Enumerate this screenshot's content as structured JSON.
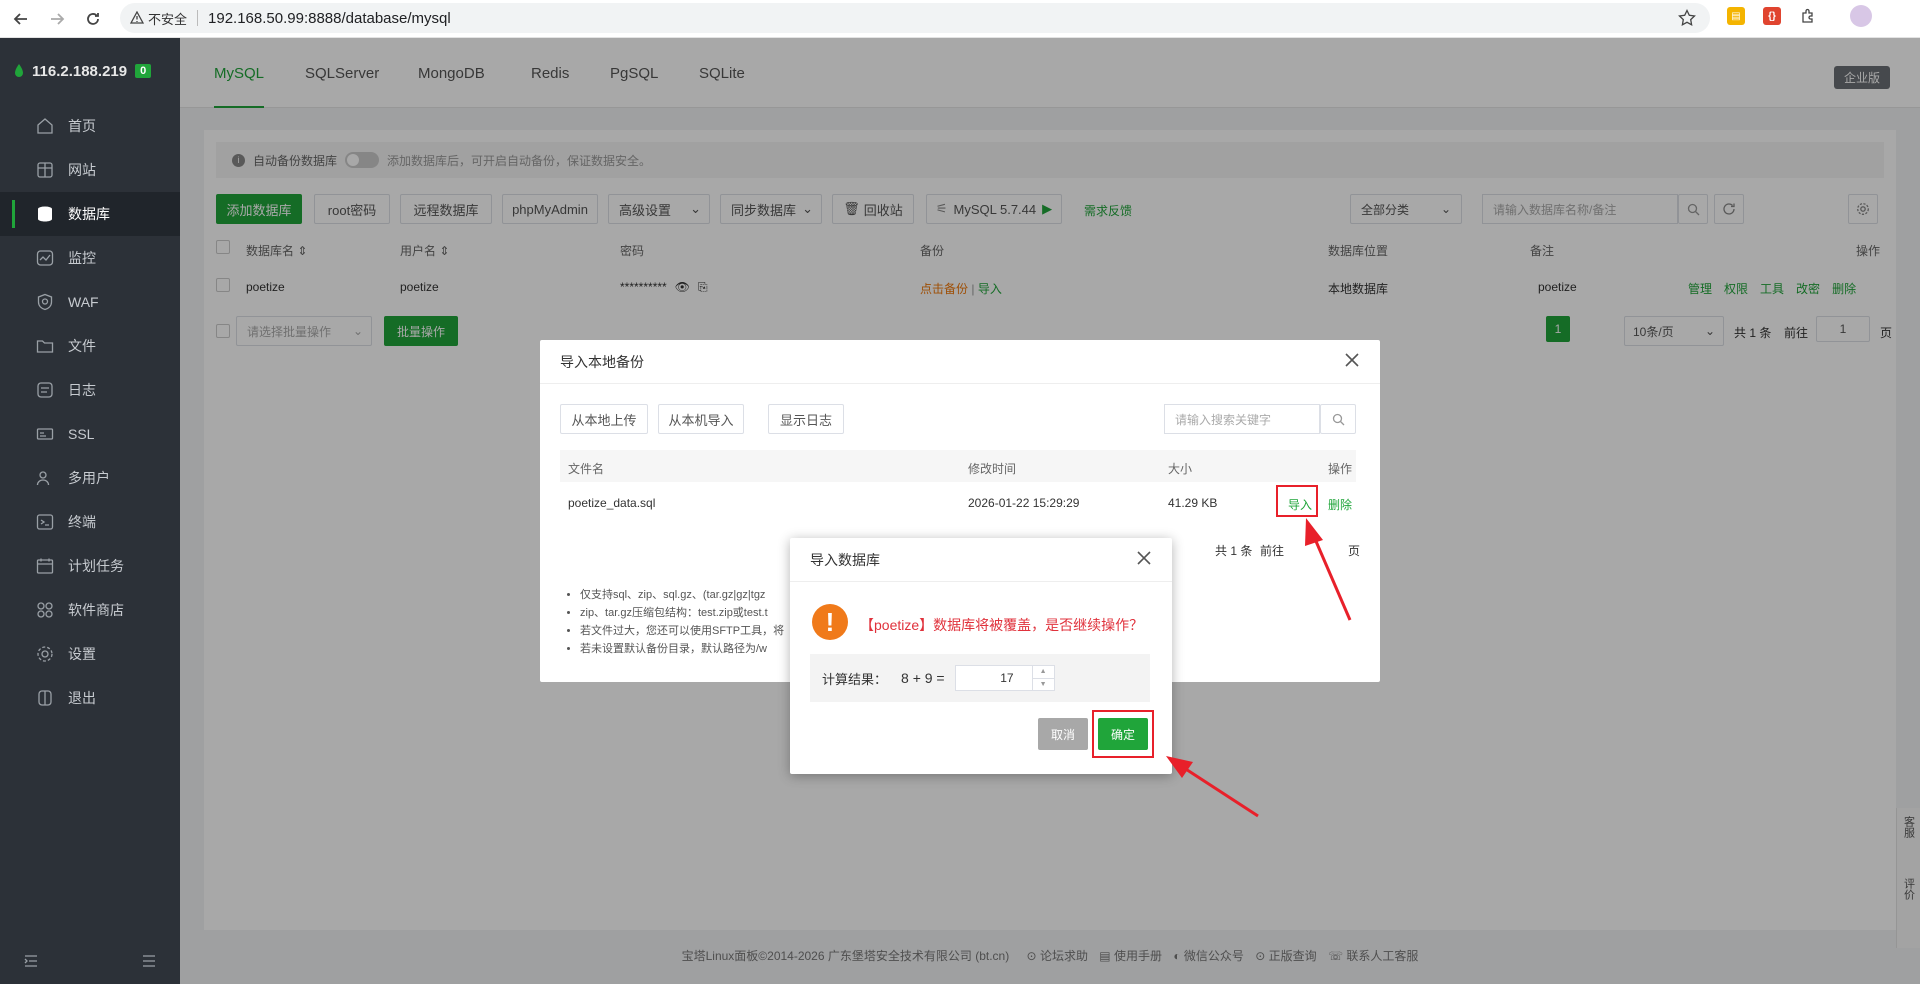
{
  "browser": {
    "insecure_label": "不安全",
    "url": "192.168.50.99:8888/database/mysql"
  },
  "sidebar": {
    "server_ip": "116.2.188.219",
    "server_count": "0",
    "items": [
      {
        "label": "首页",
        "icon": "home-icon"
      },
      {
        "label": "网站",
        "icon": "globe-icon"
      },
      {
        "label": "数据库",
        "icon": "database-icon"
      },
      {
        "label": "监控",
        "icon": "monitor-icon"
      },
      {
        "label": "WAF",
        "icon": "shield-icon"
      },
      {
        "label": "文件",
        "icon": "folder-icon"
      },
      {
        "label": "日志",
        "icon": "log-icon"
      },
      {
        "label": "SSL",
        "icon": "ssl-icon"
      },
      {
        "label": "多用户",
        "icon": "users-icon"
      },
      {
        "label": "终端",
        "icon": "terminal-icon"
      },
      {
        "label": "计划任务",
        "icon": "calendar-icon"
      },
      {
        "label": "软件商店",
        "icon": "apps-icon"
      },
      {
        "label": "设置",
        "icon": "gear-icon"
      },
      {
        "label": "退出",
        "icon": "logout-icon"
      }
    ]
  },
  "tabs": [
    "MySQL",
    "SQLServer",
    "MongoDB",
    "Redis",
    "PgSQL",
    "SQLite"
  ],
  "enterprise_label": "企业版",
  "notice": {
    "label": "自动备份数据库",
    "hint": "添加数据库后，可开启自动备份，保证数据安全。"
  },
  "toolbar": {
    "add_db": "添加数据库",
    "root_pwd": "root密码",
    "remote_db": "远程数据库",
    "phpmyadmin": "phpMyAdmin",
    "advanced": "高级设置",
    "sync_db": "同步数据库",
    "recycle": "回收站",
    "mysql_version": "MySQL 5.7.44",
    "feedback": "需求反馈",
    "category": "全部分类",
    "search_placeholder": "请输入数据库名称/备注"
  },
  "table": {
    "headers": {
      "name": "数据库名",
      "user": "用户名",
      "password": "密码",
      "backup": "备份",
      "location": "数据库位置",
      "remark": "备注",
      "ops": "操作"
    },
    "rows": [
      {
        "name": "poetize",
        "user": "poetize",
        "password": "**********",
        "backup": "点击备份",
        "import": "导入",
        "location": "本地数据库",
        "remark": "poetize",
        "ops": [
          "管理",
          "权限",
          "工具",
          "改密",
          "删除"
        ]
      }
    ],
    "batch_placeholder": "请选择批量操作",
    "batch_button": "批量操作",
    "page": "1",
    "page_size": "10条/页",
    "total": "共 1 条",
    "goto": "前往",
    "goto_value": "1",
    "page_unit": "页"
  },
  "footer": {
    "copyright": "宝塔Linux面板©2014-2026 广东堡塔安全技术有限公司 (bt.cn)",
    "links": [
      "论坛求助",
      "使用手册",
      "微信公众号",
      "正版查询",
      "联系人工客服"
    ]
  },
  "side_widget": [
    "客服",
    "评价"
  ],
  "import_dialog": {
    "title": "导入本地备份",
    "upload_local": "从本地上传",
    "import_from_server": "从本机导入",
    "show_log": "显示日志",
    "search_placeholder": "请输入搜索关键字",
    "headers": {
      "filename": "文件名",
      "mtime": "修改时间",
      "size": "大小",
      "ops": "操作"
    },
    "rows": [
      {
        "filename": "poetize_data.sql",
        "mtime": "2026-01-22 15:29:29",
        "size": "41.29 KB",
        "import": "导入",
        "delete": "删除"
      }
    ],
    "total": "共 1 条",
    "goto": "前往",
    "page_unit": "页",
    "notes": [
      "仅支持sql、zip、sql.gz、(tar.gz|gz|tgz",
      "zip、tar.gz压缩包结构：test.zip或test.t",
      "若文件过大，您还可以使用SFTP工具，将",
      "若未设置默认备份目录，默认路径为/w"
    ]
  },
  "confirm_dialog": {
    "title": "导入数据库",
    "message": "【poetize】数据库将被覆盖，是否继续操作？",
    "calc_label": "计算结果：",
    "expression": "8 + 9  =",
    "answer": "17",
    "cancel": "取消",
    "confirm": "确定"
  }
}
